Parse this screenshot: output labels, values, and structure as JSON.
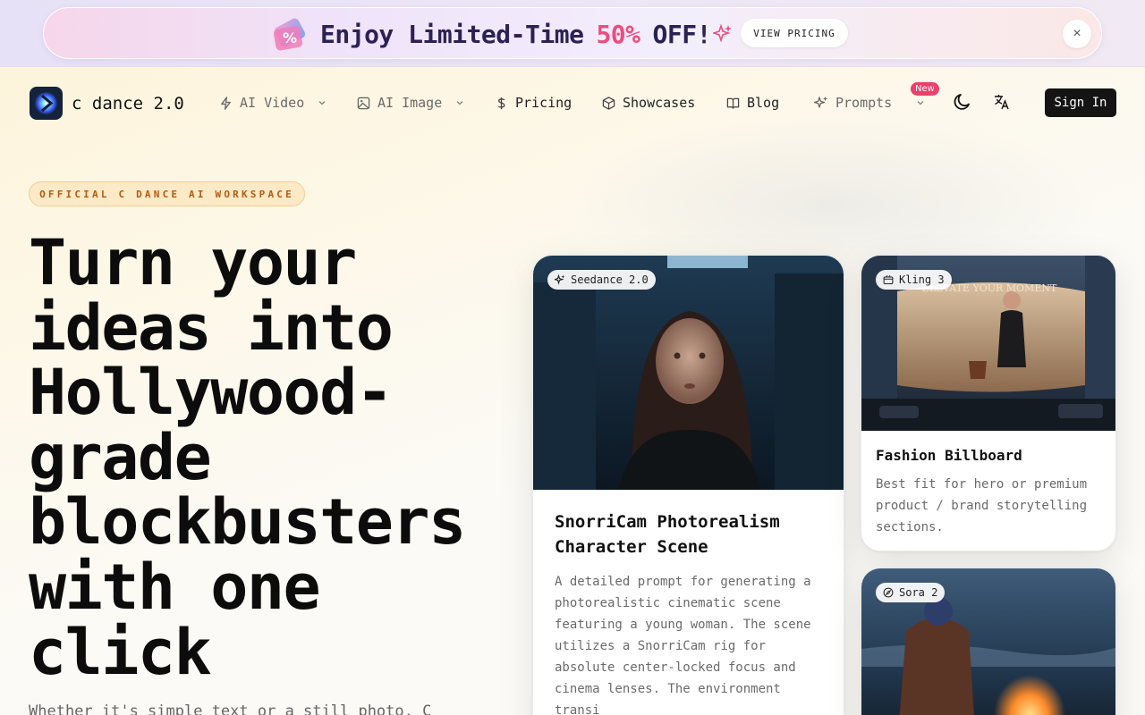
{
  "promo": {
    "text_before": "Enjoy Limited-Time",
    "highlight": "50%",
    "text_after": "OFF!",
    "button_label": "VIEW PRICING",
    "close_icon": "×",
    "colors": {
      "highlight": "#ef4c7d",
      "text": "#2b2254"
    }
  },
  "nav": {
    "brand": "c dance 2.0",
    "items": [
      {
        "label": "AI Video",
        "icon": "lightning-icon",
        "dropdown": true,
        "muted": true
      },
      {
        "label": "AI Image",
        "icon": "image-icon",
        "dropdown": true,
        "muted": true
      },
      {
        "label": "Pricing",
        "icon": "dollar-icon",
        "dropdown": false
      },
      {
        "label": "Showcases",
        "icon": "cube-icon",
        "dropdown": false
      },
      {
        "label": "Blog",
        "icon": "book-icon",
        "dropdown": false
      },
      {
        "label": "Prompts",
        "icon": "sparkles-icon",
        "dropdown": true,
        "muted": true
      }
    ],
    "new_badge": "New",
    "signin_label": "Sign In"
  },
  "hero": {
    "pill": "OFFICIAL C DANCE AI WORKSPACE",
    "title": "Turn your ideas into Hollywood-grade blockbusters with one click",
    "subtitle": "Whether it's simple text or a still photo, C"
  },
  "cards": {
    "main": {
      "tag": "Seedance 2.0",
      "title": "SnorriCam Photorealism Character Scene",
      "description": "A detailed prompt for generating a photorealistic cinematic scene featuring a young woman. The scene utilizes a SnorriCam rig for absolute center-locked focus and cinema lenses. The environment transi"
    },
    "fashion": {
      "tag": "Kling 3",
      "title": "Fashion Billboard",
      "description": "Best fit for hero or premium product / brand storytelling sections.",
      "billboard_text": "ELEVATE YOUR MOMENT"
    },
    "sora": {
      "tag": "Sora 2"
    }
  },
  "colors": {
    "accent_pink": "#ef4c7d",
    "pill_bg": "#fce9c6",
    "pill_text": "#b45a12",
    "signin_bg": "#141414"
  }
}
